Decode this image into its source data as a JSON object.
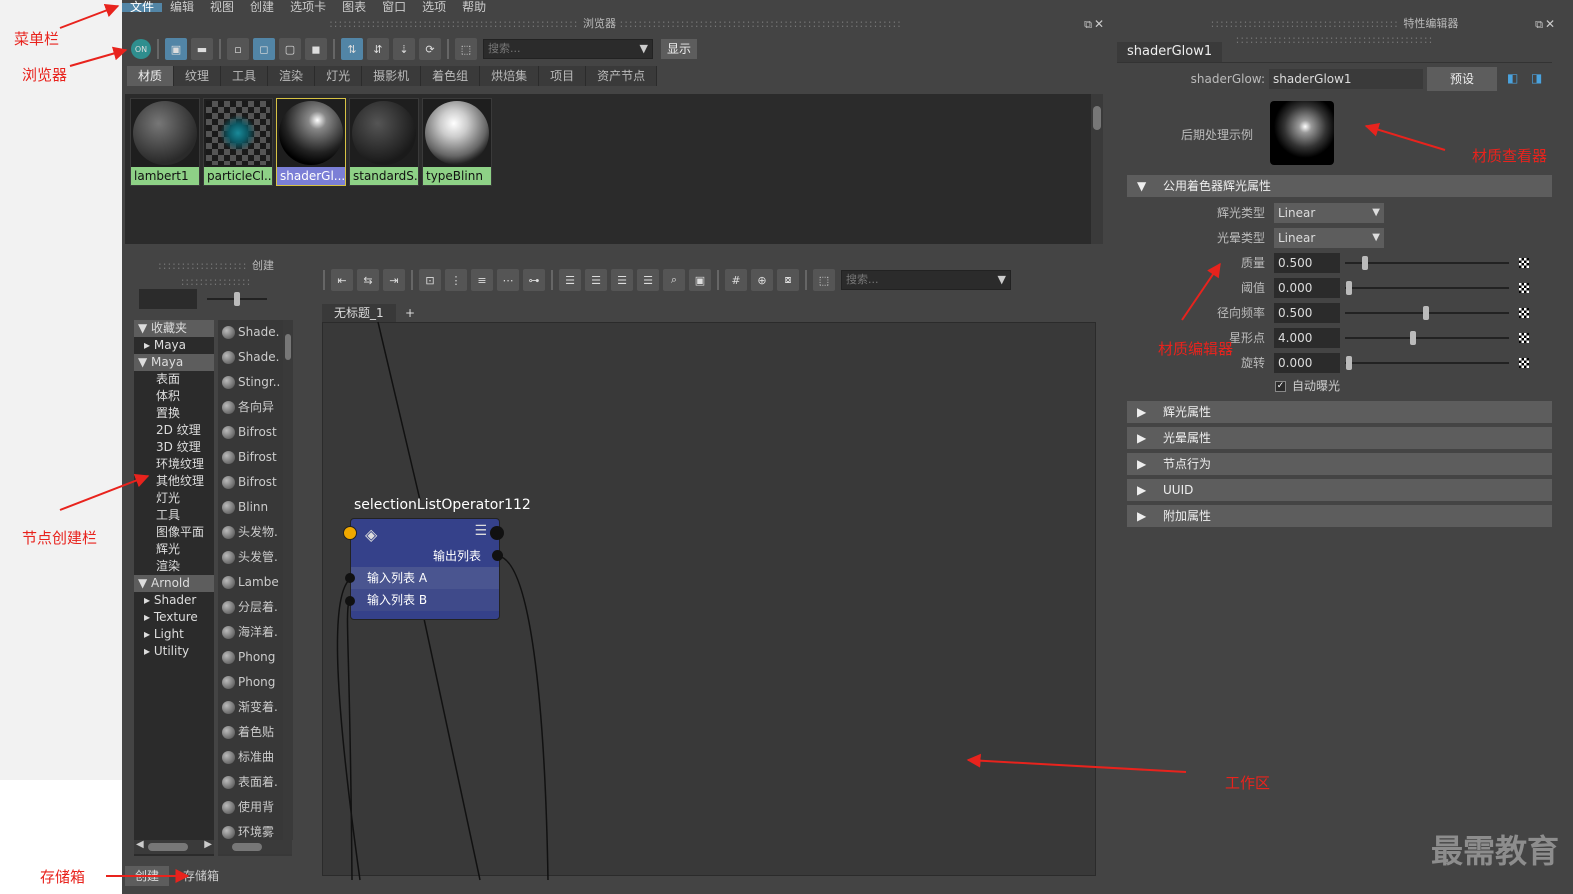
{
  "menubar": {
    "items": [
      "文件",
      "编辑",
      "视图",
      "创建",
      "选项卡",
      "图表",
      "窗口",
      "选项",
      "帮助"
    ]
  },
  "browser": {
    "title": "浏览器",
    "search_placeholder": "搜索...",
    "show_button": "显示",
    "on_label": "ON",
    "tabs": [
      "材质",
      "纹理",
      "工具",
      "渲染",
      "灯光",
      "摄影机",
      "着色组",
      "烘焙集",
      "项目",
      "资产节点"
    ],
    "swatches": [
      {
        "label": "lambert1"
      },
      {
        "label": "particleCl..."
      },
      {
        "label": "shaderGl..."
      },
      {
        "label": "standardS..."
      },
      {
        "label": "typeBlinn"
      }
    ]
  },
  "create_panel": {
    "title": "创建",
    "tree": [
      {
        "label": "收藏夹",
        "type": "cat"
      },
      {
        "label": "Maya",
        "type": "sub"
      },
      {
        "label": "Maya",
        "type": "cat"
      },
      {
        "label": "表面",
        "type": "leaf"
      },
      {
        "label": "体积",
        "type": "leaf"
      },
      {
        "label": "置换",
        "type": "leaf"
      },
      {
        "label": "2D 纹理",
        "type": "leaf"
      },
      {
        "label": "3D 纹理",
        "type": "leaf"
      },
      {
        "label": "环境纹理",
        "type": "leaf"
      },
      {
        "label": "其他纹理",
        "type": "leaf"
      },
      {
        "label": "灯光",
        "type": "leaf"
      },
      {
        "label": "工具",
        "type": "leaf"
      },
      {
        "label": "图像平面",
        "type": "leaf"
      },
      {
        "label": "辉光",
        "type": "leaf"
      },
      {
        "label": "渲染",
        "type": "leaf"
      },
      {
        "label": "Arnold",
        "type": "cat"
      },
      {
        "label": "Shader",
        "type": "sub"
      },
      {
        "label": "Texture",
        "type": "sub"
      },
      {
        "label": "Light",
        "type": "sub"
      },
      {
        "label": "Utility",
        "type": "sub"
      }
    ],
    "nodes": [
      "Shade.",
      "Shade.",
      "Stingr..",
      "各向异",
      "Bifrost",
      "Bifrost",
      "Bifrost",
      "Blinn",
      "头发物.",
      "头发管.",
      "Lambe",
      "分层着.",
      "海洋着.",
      "Phong",
      "Phong",
      "渐变着.",
      "着色贴",
      "标准曲",
      "表面着.",
      "使用背",
      "环境雾"
    ],
    "bottom_tabs": [
      "创建",
      "存储箱"
    ]
  },
  "graph": {
    "search_placeholder": "搜索...",
    "tab_label": "无标题_1",
    "add_tab": "+",
    "node": {
      "title": "selectionListOperator112",
      "output": "输出列表",
      "inputs": [
        "输入列表 A",
        "输入列表 B"
      ]
    }
  },
  "attr_editor": {
    "title": "特性编辑器",
    "tab": "shaderGlow1",
    "node_type_label": "shaderGlow:",
    "node_name": "shaderGlow1",
    "preset_button": "预设",
    "sample_label": "后期处理示例",
    "section_main": "公用着色器辉光属性",
    "glow_type_label": "辉光类型",
    "glow_type_value": "Linear",
    "halo_type_label": "光晕类型",
    "halo_type_value": "Linear",
    "sliders": [
      {
        "label": "质量",
        "value": "0.500",
        "frac": 0.1
      },
      {
        "label": "阈值",
        "value": "0.000",
        "frac": 0.0
      },
      {
        "label": "径向频率",
        "value": "0.500",
        "frac": 0.48
      },
      {
        "label": "星形点",
        "value": "4.000",
        "frac": 0.4
      },
      {
        "label": "旋转",
        "value": "0.000",
        "frac": 0.0
      }
    ],
    "auto_exposure": "自动曝光",
    "sections": [
      "辉光属性",
      "光晕属性",
      "节点行为",
      "UUID",
      "附加属性"
    ]
  },
  "annotations": {
    "menubar": "菜单栏",
    "browser": "浏览器",
    "create_bar": "节点创建栏",
    "bin": "存储箱",
    "viewer": "材质查看器",
    "editor": "材质编辑器",
    "workspace": "工作区"
  },
  "watermark": "最需教育",
  "colors": {
    "accent": "#5285a6",
    "annotation": "#e8231d",
    "swatch_label": "#8ed186",
    "node_body": "#35418a"
  }
}
